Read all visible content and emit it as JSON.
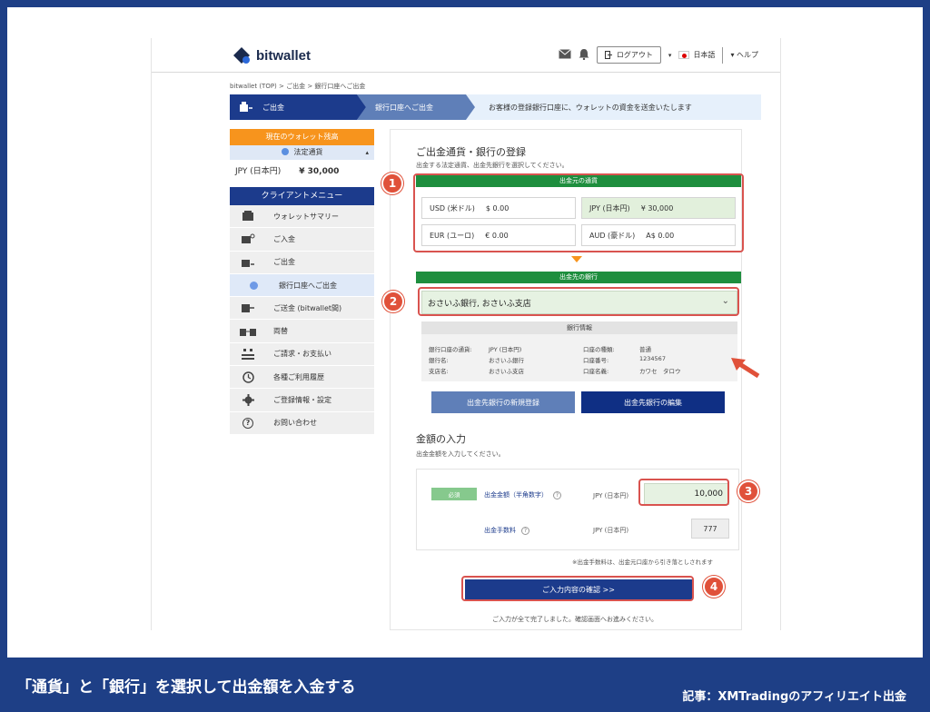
{
  "header": {
    "logo_text": "bitwallet",
    "logout_label": "ログアウト",
    "language": "日本語",
    "help_label": "ヘルプ"
  },
  "breadcrumb": "bitwallet (TOP)  >  ご出金  >  銀行口座へご出金",
  "progress": {
    "step1": "ご出金",
    "step2": "銀行口座へご出金",
    "description": "お客様の登録銀行口座に、ウォレットの資金を送金いたします"
  },
  "sidebar": {
    "wallet_title": "現在のウォレット残高",
    "wallet_subtitle": "法定通貨",
    "wallet_currency": "JPY (日本円)",
    "wallet_amount": "¥ 30,000",
    "menu_title": "クライアントメニュー",
    "menu": [
      {
        "label": "ウォレットサマリー",
        "icon": "wallet-icon"
      },
      {
        "label": "ご入金",
        "icon": "deposit-icon"
      },
      {
        "label": "ご出金",
        "icon": "withdraw-icon"
      },
      {
        "label": "銀行口座へご出金",
        "icon": "bank-sub-icon"
      },
      {
        "label": "ご送金 (bitwallet間)",
        "icon": "transfer-icon"
      },
      {
        "label": "両替",
        "icon": "exchange-icon"
      },
      {
        "label": "ご請求・お支払い",
        "icon": "billing-icon"
      },
      {
        "label": "各種ご利用履歴",
        "icon": "history-icon"
      },
      {
        "label": "ご登録情報・設定",
        "icon": "gear-icon"
      },
      {
        "label": "お問い合わせ",
        "icon": "question-icon"
      }
    ]
  },
  "main": {
    "section1_title": "ご出金通貨・銀行の登録",
    "section1_note": "出金する法定通貨、出金先銀行を選択してください。",
    "source_currency_title": "出金元の通貨",
    "currencies": [
      {
        "label": "USD (米ドル)",
        "value": "$ 0.00"
      },
      {
        "label": "JPY (日本円)",
        "value": "¥ 30,000"
      },
      {
        "label": "EUR (ユーロ)",
        "value": "€ 0.00"
      },
      {
        "label": "AUD (豪ドル)",
        "value": "A$ 0.00"
      }
    ],
    "bank_title": "出金先の銀行",
    "bank_selected": "おさいふ銀行, おさいふ支店",
    "bank_info_title": "銀行情報",
    "bank_info": [
      {
        "key": "銀行口座の通貨:",
        "value": "JPY (日本円)"
      },
      {
        "key": "口座の種類:",
        "value": "普通"
      },
      {
        "key": "銀行名:",
        "value": "おさいふ銀行"
      },
      {
        "key": "口座番号:",
        "value": "1234567"
      },
      {
        "key": "支店名:",
        "value": "おさいふ支店"
      },
      {
        "key": "口座名義:",
        "value": "カワセ　タロウ"
      }
    ],
    "new_bank_button": "出金先銀行の新規登録",
    "edit_bank_button": "出金先銀行の編集",
    "section2_title": "金額の入力",
    "section2_note": "出金金額を入力してください。",
    "required_badge": "必須",
    "amount_label": "出金金額（半角数字）",
    "amount_currency": "JPY (日本円)",
    "amount_value": "10,000",
    "fee_label": "出金手数料",
    "fee_currency": "JPY (日本円)",
    "fee_value": "777",
    "fee_note": "※出金手数料は、出金元口座から引き落としされます",
    "confirm_button": "ご入力内容の確認 >>",
    "bottom_note": "ご入力が全て完了しました。確認画面へお進みください。"
  },
  "annotations": {
    "n1": "1",
    "n2": "2",
    "n3": "3",
    "n4": "4"
  },
  "caption": {
    "left": "「通貨」と「銀行」を選択して出金額を入金する",
    "right": "記事：XMTradingのアフィリエイト出金"
  },
  "colors": {
    "navy": "#1c3b8c",
    "green": "#1e8e3e",
    "orange": "#f7941d",
    "annotation_red": "#e0513a"
  }
}
